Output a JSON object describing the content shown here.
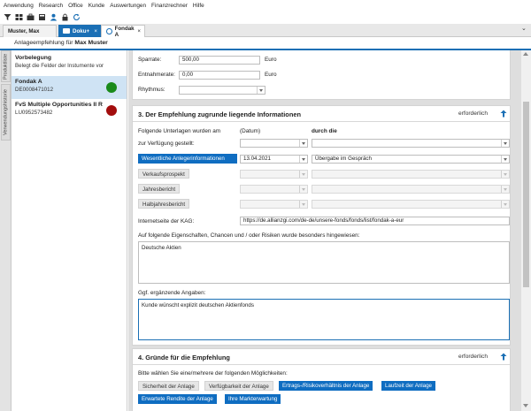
{
  "menu": [
    "Anwendung",
    "Research",
    "Office",
    "Kunde",
    "Auswertungen",
    "Finanzrechner",
    "Hilfe"
  ],
  "tabs": [
    {
      "label": "Muster, Max"
    },
    {
      "label": "Doku+",
      "close": "×"
    },
    {
      "label": "Fondak A",
      "close": "×"
    }
  ],
  "tab_dropdown": "⌄",
  "subheader": {
    "prefix": "Anlageempfehlung für ",
    "name": "Max Muster"
  },
  "left_strip": [
    "Produktliste",
    "Verwendungshistorie"
  ],
  "sidebar": {
    "vorbelegung": {
      "title": "Vorbelegung",
      "subtitle": "Belegt die Felder der Instumente vor"
    },
    "items": [
      {
        "title": "Fondak A",
        "isin": "DE0008471012",
        "status_color": "#1a8a1a"
      },
      {
        "title": "FvS Multiple Opportunities II R",
        "isin": "LU0952573482",
        "status_color": "#a30d0d"
      }
    ]
  },
  "section_top": {
    "sparrate_label": "Sparrate:",
    "sparrate_value": "500,00",
    "sparrate_unit": "Euro",
    "entnahme_label": "Entnahmerate:",
    "entnahme_value": "0,00",
    "entnahme_unit": "Euro",
    "rhythmus_label": "Rhythmus:",
    "rhythmus_value": ""
  },
  "section3": {
    "title": "3. Der Empfehlung zugrunde liegende Informationen",
    "required": "erforderlich",
    "intro_label": "Folgende Unterlagen wurden am",
    "col_datum": "(Datum)",
    "col_durch": "durch die",
    "zvg_label": "zur Verfügung gestellt:",
    "rows": [
      {
        "label": "Wesentliche Anlegerinformationen",
        "date": "13.04.2021",
        "via": "Übergabe im Gespräch",
        "active": true
      },
      {
        "label": "Verkaufsprospekt",
        "date": "",
        "via": "",
        "active": false
      },
      {
        "label": "Jahresbericht",
        "date": "",
        "via": "",
        "active": false
      },
      {
        "label": "Halbjahresbericht",
        "date": "",
        "via": "",
        "active": false
      }
    ],
    "kag_label": "Internetseite der KAG:",
    "kag_url": "https://de.allianzgi.com/de-de/unsere-fonds/fonds/list/fondak-a-eur",
    "hinweis_label": "Auf folgende Eigenschaften, Chancen und / oder Risiken wurde besonders hingewiesen:",
    "hinweis_value": "Deutsche Aktien",
    "ergaenzend_label": "Ggf. ergänzende Angaben:",
    "ergaenzend_value": "Kunde wünscht explizit deutschen Aktienfonds"
  },
  "section4": {
    "title": "4. Gründe für die Empfehlung",
    "required": "erforderlich",
    "intro": "Bitte wählen Sie eine/mehrere der folgenden Möglichkeiten:",
    "options": [
      {
        "label": "Sicherheit der Anlage",
        "selected": false
      },
      {
        "label": "Verfügbarkeit der Anlage",
        "selected": false
      },
      {
        "label": "Ertrags-/Risikoverhältnis der Anlage",
        "selected": true
      },
      {
        "label": "Laufzeit der Anlage",
        "selected": true
      },
      {
        "label": "Erwartete Rendite der Anlage",
        "selected": true
      },
      {
        "label": "Ihre Markterwartung",
        "selected": true
      }
    ]
  },
  "colors": {
    "accent": "#0f6dc1",
    "tab_active": "#1a6fb5",
    "green": "#1a8a1a",
    "red": "#a30d0d"
  }
}
